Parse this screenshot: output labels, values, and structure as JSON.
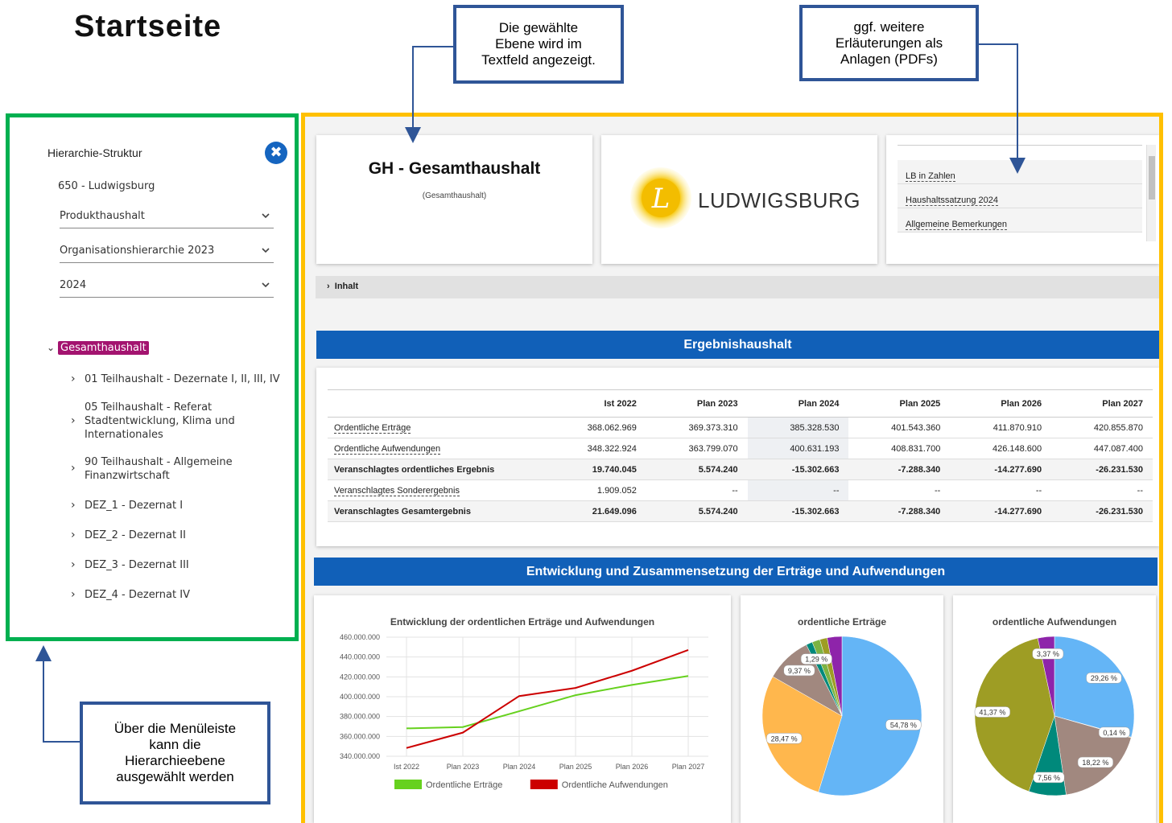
{
  "page_title": "Startseite",
  "callouts": {
    "top_middle": "Die gewählte\nEbene wird im\nTextfeld angezeigt.",
    "top_right": "ggf. weitere\nErläuterungen als\nAnlagen (PDFs)",
    "bottom_left": "Über die Menüleiste\nkann die\nHierarchieebene\nausgewählt werden"
  },
  "sidebar": {
    "title": "Hierarchie-Struktur",
    "close_glyph": "✖",
    "city": "650 - Ludwigsburg",
    "selects": [
      "Produkthaushalt",
      "Organisationshierarchie 2023",
      "2024"
    ],
    "root": "Gesamthaushalt",
    "items": [
      "01 Teilhaushalt - Dezernate I, II, III, IV",
      "05 Teilhaushalt - Referat Stadtentwicklung, Klima und Internationales",
      "90 Teilhaushalt - Allgemeine Finanzwirtschaft",
      "DEZ_1 - Dezernat I",
      "DEZ_2 - Dezernat II",
      "DEZ_3 - Dezernat III",
      "DEZ_4 - Dezernat IV"
    ]
  },
  "header_card": {
    "title": "GH - Gesamthaushalt",
    "subtitle": "(Gesamthaushalt)"
  },
  "logo": {
    "text": "LUDWIGSBURG",
    "accent": "#f5c400"
  },
  "attachments": [
    "LB in Zahlen",
    "Haushaltssatzung 2024",
    "Allgemeine Bemerkungen"
  ],
  "inhalt_label": "Inhalt",
  "ergebnis": {
    "header": "Ergebnishaushalt",
    "columns": [
      "",
      "Ist 2022",
      "Plan 2023",
      "Plan 2024",
      "Plan 2025",
      "Plan 2026",
      "Plan 2027"
    ],
    "rows": [
      {
        "label": "Ordentliche Erträge",
        "bold": false,
        "values": [
          "368.062.969",
          "369.373.310",
          "385.328.530",
          "401.543.360",
          "411.870.910",
          "420.855.870"
        ]
      },
      {
        "label": "Ordentliche Aufwendungen",
        "bold": false,
        "values": [
          "348.322.924",
          "363.799.070",
          "400.631.193",
          "408.831.700",
          "426.148.600",
          "447.087.400"
        ]
      },
      {
        "label": "Veranschlagtes ordentliches Ergebnis",
        "bold": true,
        "values": [
          "19.740.045",
          "5.574.240",
          "-15.302.663",
          "-7.288.340",
          "-14.277.690",
          "-26.231.530"
        ]
      },
      {
        "label": "Veranschlagtes Sonderergebnis",
        "bold": false,
        "values": [
          "1.909.052",
          "--",
          "--",
          "--",
          "--",
          "--"
        ]
      },
      {
        "label": "Veranschlagtes Gesamtergebnis",
        "bold": true,
        "values": [
          "21.649.096",
          "5.574.240",
          "-15.302.663",
          "-7.288.340",
          "-14.277.690",
          "-26.231.530"
        ]
      }
    ]
  },
  "entwicklung_header": "Entwicklung und Zusammensetzung der Erträge und Aufwendungen",
  "chart_data": [
    {
      "type": "line",
      "title": "Entwicklung der ordentlichen Erträge und Aufwendungen",
      "categories": [
        "Ist 2022",
        "Plan 2023",
        "Plan 2024",
        "Plan 2025",
        "Plan 2026",
        "Plan 2027"
      ],
      "ylim": [
        340000000,
        460000000
      ],
      "yticks": [
        "340.000.000",
        "360.000.000",
        "380.000.000",
        "400.000.000",
        "420.000.000",
        "440.000.000",
        "460.000.000"
      ],
      "grid": true,
      "legend_position": "bottom",
      "series": [
        {
          "name": "Ordentliche Erträge",
          "color": "#66d11e",
          "values": [
            368062969,
            369373310,
            385328530,
            401543360,
            411870910,
            420855870
          ]
        },
        {
          "name": "Ordentliche Aufwendungen",
          "color": "#cc0000",
          "values": [
            348322924,
            363799070,
            400631193,
            408831700,
            426148600,
            447087400
          ]
        }
      ]
    },
    {
      "type": "pie",
      "title": "ordentliche Erträge",
      "slices": [
        {
          "value": 54.78,
          "label": "54,78 %",
          "color": "#64b5f6"
        },
        {
          "value": 28.47,
          "label": "28,47 %",
          "color": "#ffb74d"
        },
        {
          "value": 9.37,
          "label": "9,37 %",
          "color": "#a1887f"
        },
        {
          "value": 1.29,
          "label": "1,29 %",
          "color": "#00897b"
        },
        {
          "value": 1.6,
          "label": "",
          "color": "#7cb342"
        },
        {
          "value": 1.5,
          "label": "",
          "color": "#9e9d24"
        },
        {
          "value": 2.99,
          "label": "",
          "color": "#8e24aa"
        }
      ]
    },
    {
      "type": "pie",
      "title": "ordentliche Aufwendungen",
      "slices": [
        {
          "value": 29.26,
          "label": "29,26 %",
          "color": "#64b5f6"
        },
        {
          "value": 0.14,
          "label": "0,14 %",
          "color": "#ffb74d"
        },
        {
          "value": 18.22,
          "label": "18,22 %",
          "color": "#a1887f"
        },
        {
          "value": 7.56,
          "label": "7,56 %",
          "color": "#00897b"
        },
        {
          "value": 41.37,
          "label": "41,37 %",
          "color": "#9e9d24"
        },
        {
          "value": 3.37,
          "label": "3,37 %",
          "color": "#8e24aa"
        }
      ]
    }
  ]
}
